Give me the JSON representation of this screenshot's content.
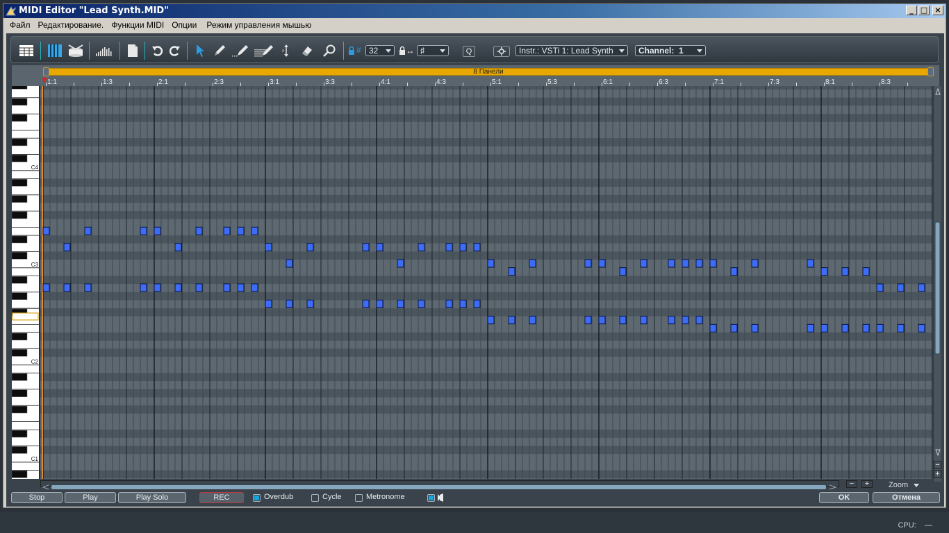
{
  "window": {
    "title": "MIDI Editor \"Lead Synth.MID\"",
    "controls": [
      "_",
      "□",
      "×"
    ]
  },
  "menu": [
    "Файл",
    "Редактирование.",
    "Функции MIDI",
    "Опции",
    "Режим управления мышью"
  ],
  "toolbar": {
    "icons": [
      "list-editor-icon",
      "piano-roll-icon",
      "drum-editor-icon",
      "velocity-icon",
      "new-document-icon",
      "undo-icon",
      "redo-icon",
      "pointer-icon",
      "pencil-icon",
      "line-pencil-icon",
      "multi-pencil-icon",
      "split-icon",
      "eraser-icon",
      "zoom-icon"
    ],
    "quantize_label": "#",
    "quantize_value": "32",
    "length_label": "↔",
    "length_value": "♯",
    "q_button": "Q",
    "instrument": "Instr.: VSTi 1: Lead Synth",
    "channel": "Channel:  1"
  },
  "ruler": {
    "region_label": "8 Панели",
    "labels": [
      "1:1",
      "1:3",
      "2:1",
      "2:3",
      "3:1",
      "3:3",
      "4:1",
      "4:3",
      "5:1",
      "5:3",
      "6:1",
      "6:3",
      "7:1",
      "7:3",
      "8:1",
      "8:3"
    ]
  },
  "piano": {
    "labels": [
      "C4",
      "C3",
      "C2",
      "C1"
    ]
  },
  "notes": [
    {
      "step": 0,
      "pitch": "E3"
    },
    {
      "step": 6,
      "pitch": "E3"
    },
    {
      "step": 14,
      "pitch": "E3"
    },
    {
      "step": 16,
      "pitch": "E3"
    },
    {
      "step": 22,
      "pitch": "E3"
    },
    {
      "step": 26,
      "pitch": "E3"
    },
    {
      "step": 28,
      "pitch": "E3"
    },
    {
      "step": 30,
      "pitch": "E3"
    },
    {
      "step": 3,
      "pitch": "D3"
    },
    {
      "step": 19,
      "pitch": "D3"
    },
    {
      "step": 32,
      "pitch": "D3"
    },
    {
      "step": 38,
      "pitch": "D3"
    },
    {
      "step": 46,
      "pitch": "D3"
    },
    {
      "step": 48,
      "pitch": "D3"
    },
    {
      "step": 54,
      "pitch": "D3"
    },
    {
      "step": 58,
      "pitch": "D3"
    },
    {
      "step": 60,
      "pitch": "D3"
    },
    {
      "step": 62,
      "pitch": "D3"
    },
    {
      "step": 35,
      "pitch": "C3"
    },
    {
      "step": 51,
      "pitch": "C3"
    },
    {
      "step": 64,
      "pitch": "C3"
    },
    {
      "step": 70,
      "pitch": "C3"
    },
    {
      "step": 78,
      "pitch": "C3"
    },
    {
      "step": 80,
      "pitch": "C3"
    },
    {
      "step": 86,
      "pitch": "C3"
    },
    {
      "step": 90,
      "pitch": "C3"
    },
    {
      "step": 92,
      "pitch": "C3"
    },
    {
      "step": 94,
      "pitch": "C3"
    },
    {
      "step": 96,
      "pitch": "C3"
    },
    {
      "step": 102,
      "pitch": "C3"
    },
    {
      "step": 110,
      "pitch": "C3"
    },
    {
      "step": 67,
      "pitch": "B2"
    },
    {
      "step": 83,
      "pitch": "B2"
    },
    {
      "step": 99,
      "pitch": "B2"
    },
    {
      "step": 112,
      "pitch": "B2"
    },
    {
      "step": 115,
      "pitch": "B2"
    },
    {
      "step": 118,
      "pitch": "B2"
    },
    {
      "step": 0,
      "pitch": "A2"
    },
    {
      "step": 3,
      "pitch": "A2"
    },
    {
      "step": 6,
      "pitch": "A2"
    },
    {
      "step": 14,
      "pitch": "A2"
    },
    {
      "step": 16,
      "pitch": "A2"
    },
    {
      "step": 19,
      "pitch": "A2"
    },
    {
      "step": 22,
      "pitch": "A2"
    },
    {
      "step": 26,
      "pitch": "A2"
    },
    {
      "step": 28,
      "pitch": "A2"
    },
    {
      "step": 30,
      "pitch": "A2"
    },
    {
      "step": 120,
      "pitch": "A2"
    },
    {
      "step": 123,
      "pitch": "A2"
    },
    {
      "step": 126,
      "pitch": "A2"
    },
    {
      "step": 32,
      "pitch": "G2"
    },
    {
      "step": 35,
      "pitch": "G2"
    },
    {
      "step": 38,
      "pitch": "G2"
    },
    {
      "step": 46,
      "pitch": "G2"
    },
    {
      "step": 48,
      "pitch": "G2"
    },
    {
      "step": 51,
      "pitch": "G2"
    },
    {
      "step": 54,
      "pitch": "G2"
    },
    {
      "step": 58,
      "pitch": "G2"
    },
    {
      "step": 60,
      "pitch": "G2"
    },
    {
      "step": 62,
      "pitch": "G2"
    },
    {
      "step": 64,
      "pitch": "F2"
    },
    {
      "step": 67,
      "pitch": "F2"
    },
    {
      "step": 70,
      "pitch": "F2"
    },
    {
      "step": 78,
      "pitch": "F2"
    },
    {
      "step": 80,
      "pitch": "F2"
    },
    {
      "step": 83,
      "pitch": "F2"
    },
    {
      "step": 86,
      "pitch": "F2"
    },
    {
      "step": 90,
      "pitch": "F2"
    },
    {
      "step": 92,
      "pitch": "F2"
    },
    {
      "step": 94,
      "pitch": "F2"
    },
    {
      "step": 96,
      "pitch": "E2"
    },
    {
      "step": 99,
      "pitch": "E2"
    },
    {
      "step": 102,
      "pitch": "E2"
    },
    {
      "step": 110,
      "pitch": "E2"
    },
    {
      "step": 112,
      "pitch": "E2"
    },
    {
      "step": 115,
      "pitch": "E2"
    },
    {
      "step": 118,
      "pitch": "E2"
    },
    {
      "step": 120,
      "pitch": "E2"
    },
    {
      "step": 123,
      "pitch": "E2"
    },
    {
      "step": 126,
      "pitch": "E2"
    }
  ],
  "note_color": "#3d6cf5",
  "zoom": {
    "minus": "−",
    "plus": "+",
    "label": "Zoom"
  },
  "transport": {
    "stop": "Stop",
    "play": "Play",
    "play_solo": "Play Solo",
    "rec": "REC",
    "overdub": {
      "label": "Overdub",
      "checked": true
    },
    "cycle": {
      "label": "Cycle",
      "checked": false
    },
    "metronome": {
      "label": "Metronome",
      "checked": false
    },
    "extra_checked": true
  },
  "dialog": {
    "ok": "OK",
    "cancel": "Отмена"
  },
  "status": {
    "cpu": "CPU:    —"
  }
}
